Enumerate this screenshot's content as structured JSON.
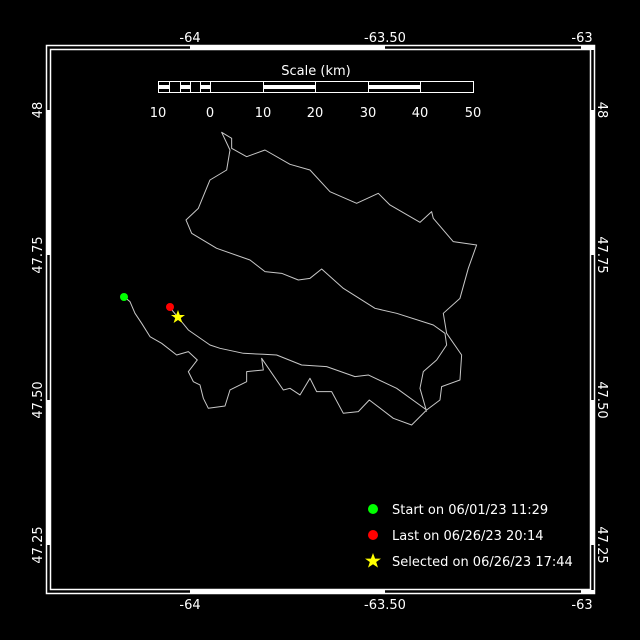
{
  "map": {
    "x_ticks": [
      "-64",
      "-63.50",
      "-63"
    ],
    "y_ticks": [
      "48",
      "47.75",
      "47.50",
      "47.25"
    ],
    "scale_bar": {
      "title": "Scale (km)",
      "labels": [
        "10",
        "0",
        "10",
        "20",
        "30",
        "40",
        "50"
      ]
    },
    "legend": [
      {
        "label": "Start on 06/01/23 11:29",
        "symbol": "circle",
        "color": "#00ff00"
      },
      {
        "label": "Last on 06/26/23 20:14",
        "symbol": "circle",
        "color": "#ff0000"
      },
      {
        "label": "Selected on 06/26/23 17:44",
        "symbol": "star",
        "color": "#ffff00"
      }
    ],
    "colors": {
      "background": "#000000",
      "frame": "#ffffff",
      "track": "#c8c8c8"
    }
  }
}
